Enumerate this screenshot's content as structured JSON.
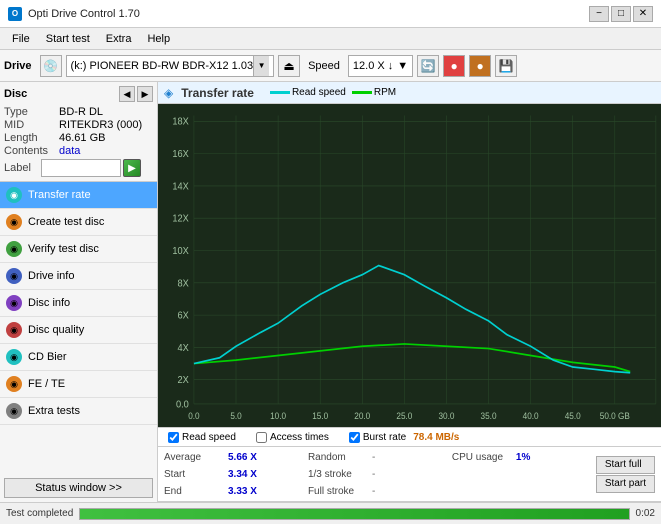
{
  "titlebar": {
    "icon_label": "O",
    "title": "Opti Drive Control 1.70",
    "btn_minimize": "−",
    "btn_maximize": "□",
    "btn_close": "✕"
  },
  "menubar": {
    "items": [
      "File",
      "Start test",
      "Extra",
      "Help"
    ]
  },
  "toolbar": {
    "drive_label": "Drive",
    "drive_value": "(k:) PIONEER BD-RW  BDR-X12 1.03",
    "speed_label": "Speed",
    "speed_value": "12.0 X ↓"
  },
  "disc": {
    "title": "Disc",
    "type_label": "Type",
    "type_value": "BD-R DL",
    "mid_label": "MID",
    "mid_value": "RITEKDR3 (000)",
    "length_label": "Length",
    "length_value": "46.61 GB",
    "contents_label": "Contents",
    "contents_value": "data",
    "label_label": "Label",
    "label_value": ""
  },
  "nav": {
    "items": [
      {
        "id": "transfer-rate",
        "label": "Transfer rate",
        "icon": "teal",
        "active": true
      },
      {
        "id": "create-test-disc",
        "label": "Create test disc",
        "icon": "orange",
        "active": false
      },
      {
        "id": "verify-test-disc",
        "label": "Verify test disc",
        "icon": "green",
        "active": false
      },
      {
        "id": "drive-info",
        "label": "Drive info",
        "icon": "blue-ic",
        "active": false
      },
      {
        "id": "disc-info",
        "label": "Disc info",
        "icon": "purple",
        "active": false
      },
      {
        "id": "disc-quality",
        "label": "Disc quality",
        "icon": "red",
        "active": false
      },
      {
        "id": "cd-bier",
        "label": "CD Bier",
        "icon": "teal",
        "active": false
      },
      {
        "id": "fe-te",
        "label": "FE / TE",
        "icon": "orange",
        "active": false
      },
      {
        "id": "extra-tests",
        "label": "Extra tests",
        "icon": "gray",
        "active": false
      }
    ],
    "status_btn": "Status window >>"
  },
  "chart": {
    "title": "Transfer rate",
    "legend": [
      {
        "label": "Read speed",
        "color": "#00d0d0"
      },
      {
        "label": "RPM",
        "color": "#00d000"
      }
    ],
    "y_axis": [
      "18X",
      "16X",
      "14X",
      "12X",
      "10X",
      "8X",
      "6X",
      "4X",
      "2X",
      "0.0"
    ],
    "x_axis": [
      "0.0",
      "5.0",
      "10.0",
      "15.0",
      "20.0",
      "25.0",
      "30.0",
      "35.0",
      "40.0",
      "45.0",
      "50.0 GB"
    ],
    "checkboxes": [
      {
        "label": "Read speed",
        "checked": true
      },
      {
        "label": "Access times",
        "checked": false
      },
      {
        "label": "Burst rate",
        "checked": true
      }
    ],
    "burst_value": "78.4 MB/s"
  },
  "stats": {
    "average_label": "Average",
    "average_value": "5.66 X",
    "random_label": "Random",
    "random_value": "-",
    "cpu_label": "CPU usage",
    "cpu_value": "1%",
    "start_label": "Start",
    "start_value": "3.34 X",
    "stroke1_label": "1/3 stroke",
    "stroke1_value": "-",
    "end_label": "End",
    "end_value": "3.33 X",
    "stroke2_label": "Full stroke",
    "stroke2_value": "-",
    "start_full_btn": "Start full",
    "start_part_btn": "Start part"
  },
  "statusbar": {
    "text": "Test completed",
    "progress": 100,
    "time": "0:02"
  }
}
